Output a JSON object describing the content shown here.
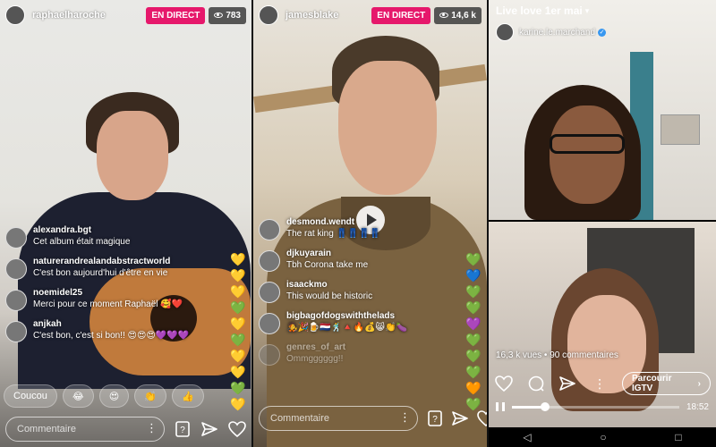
{
  "panel1": {
    "username": "raphaelharoche",
    "live_label": "EN DIRECT",
    "viewer_count": "783",
    "comments": [
      {
        "user": "alexandra.bgt",
        "text": "Cet album était magique"
      },
      {
        "user": "naturerandrealandabstractworld",
        "text": "C'est bon aujourd'hui d'être en vie"
      },
      {
        "user": "noemidel25",
        "text": "Merci pour ce moment Raphaël 🥰❤️"
      },
      {
        "user": "anjkah",
        "text": "C'est bon, c'est si bon!! 😍😍😍💜💜💜"
      }
    ],
    "reactions": [
      "Coucou",
      "😂",
      "😍",
      "👏",
      "👍"
    ],
    "comment_placeholder": "Commentaire",
    "hearts": [
      "💛",
      "💚",
      "💛",
      "💛",
      "💚",
      "💛",
      "💚",
      "💛",
      "💛",
      "💛",
      "💜"
    ]
  },
  "panel2": {
    "username": "jamesblake",
    "live_label": "EN DIRECT",
    "viewer_count": "14,6 k",
    "comments": [
      {
        "user": "desmond.wendt",
        "text": "The rat king 👖👖👖👖"
      },
      {
        "user": "djkuyarain",
        "text": "Tbh Corona take me"
      },
      {
        "user": "isaackmo",
        "text": "This would be historic"
      },
      {
        "user": "bigbagofdogswiththelads",
        "text": "🧑‍🎤🎉🍺🇳🇱🕺🔺🔥💰😸👏🍆"
      },
      {
        "user": "genres_of_art",
        "text": "Ommgggggg!!"
      }
    ],
    "comment_placeholder": "Commentaire",
    "hearts": [
      "💚",
      "🧡",
      "💚",
      "💚",
      "💚",
      "💜",
      "💚",
      "💚",
      "💙",
      "💚"
    ]
  },
  "panel3": {
    "title": "Live love 1er mai",
    "username": "karine.le.marchand",
    "stats": "16,3 k vues • 90 commentaires",
    "browse_label": "Parcourir IGTV",
    "duration": "18:52",
    "progress": 0.2
  },
  "icons": {
    "send": "paper-plane",
    "like": "heart",
    "question": "question-box",
    "comment": "speech-bubble"
  }
}
